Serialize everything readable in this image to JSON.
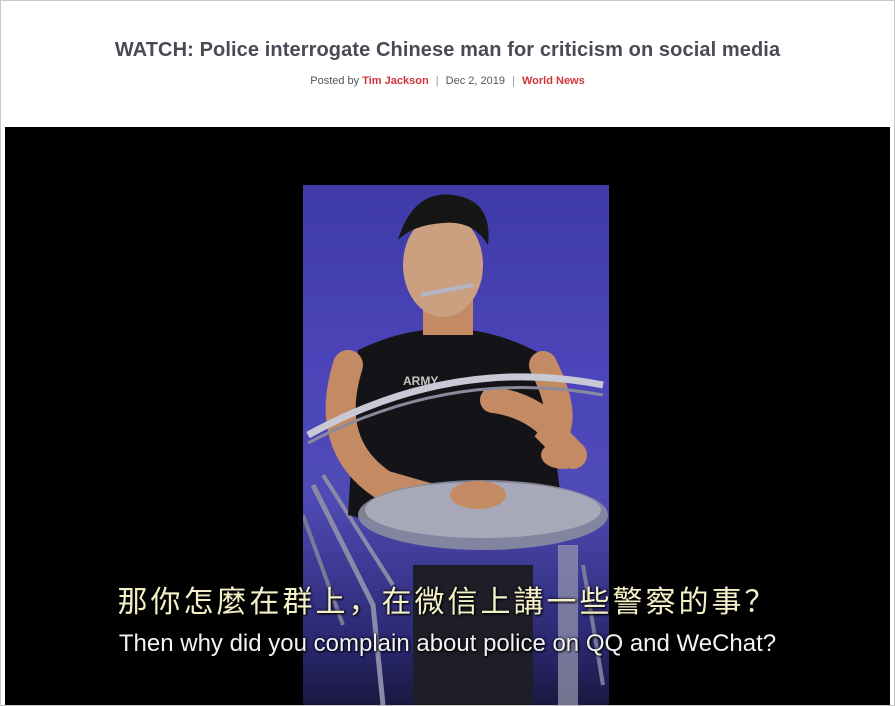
{
  "article": {
    "title": "WATCH: Police interrogate Chinese man for criticism on social media",
    "posted_by_prefix": "Posted by",
    "author": "Tim Jackson",
    "separator": "|",
    "date": "Dec 2, 2019",
    "category": "World News"
  },
  "video": {
    "subtitle_chinese": "那你怎麼在群上，在微信上講一些警察的事？",
    "subtitle_english": "Then why did you complain about police on QQ and WeChat?",
    "shirt_text": "ARMY"
  },
  "colors": {
    "accent": "#d0343a",
    "title": "#4a4a55",
    "video_bg": "#000000",
    "frame_bg": "#4b45b9"
  }
}
